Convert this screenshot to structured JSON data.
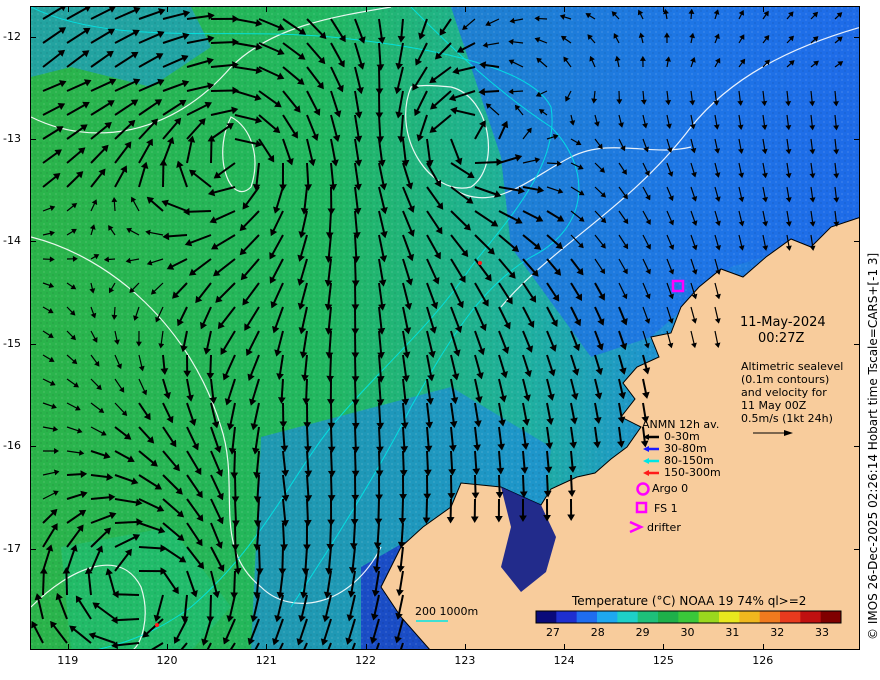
{
  "map": {
    "y_ticks": [
      "-12",
      "-13",
      "-14",
      "-15",
      "-16",
      "-17"
    ],
    "x_ticks": [
      "119",
      "120",
      "121",
      "122",
      "123",
      "124",
      "125",
      "126"
    ],
    "lat_range": [
      -17.99,
      -11.7
    ],
    "lon_range": [
      118.62,
      126.98
    ]
  },
  "annotation": {
    "date": "11-May-2024",
    "time": "00:27Z",
    "altimetry_lines": [
      "Altimetric sealevel",
      "(0.1m contours)",
      "and velocity for",
      "11 May 00Z",
      "0.5m/s (1kt 24h)"
    ]
  },
  "legend": {
    "title": "ANMN 12h av.",
    "items": [
      {
        "label": "0-30m",
        "color": "#000000"
      },
      {
        "label": "30-80m",
        "color": "#1a1aff"
      },
      {
        "label": "80-150m",
        "color": "#00e5e5"
      },
      {
        "label": "150-300m",
        "color": "#ff1a1a"
      }
    ],
    "markers": [
      {
        "label": "Argo 0",
        "symbol": "circle",
        "color": "#ff00ff"
      },
      {
        "label": "FS 1",
        "symbol": "square",
        "color": "#ff00ff"
      },
      {
        "label": "drifter",
        "symbol": "chevron",
        "color": "#ff00ff"
      }
    ]
  },
  "colorbar": {
    "title": "Temperature (°C) NOAA 19 74% ql>=2",
    "ticks": [
      "27",
      "28",
      "29",
      "30",
      "31",
      "32",
      "33"
    ],
    "colors": [
      "#0a0a7a",
      "#1e2fd0",
      "#1f6df0",
      "#1ea8f0",
      "#1ed0c8",
      "#1ec07a",
      "#1eb04a",
      "#3ac83a",
      "#9ad81e",
      "#e8e81e",
      "#f0b81e",
      "#f07a1e",
      "#e83a1e",
      "#c01010",
      "#800000"
    ]
  },
  "bathymetry": {
    "label": "200  1000m",
    "color": "#00e5e5"
  },
  "credit": "© IMOS 26-Dec-2025 02:26:14 Hobart time Tscale=CARS+[-1 3]",
  "colors": {
    "land": "#f8cc9c",
    "ocean_warm": "#1eb84a",
    "ocean_cool": "#1f78e8",
    "contour": "#ffffff",
    "bathy": "#00e5e5",
    "arrow": "#000000"
  }
}
